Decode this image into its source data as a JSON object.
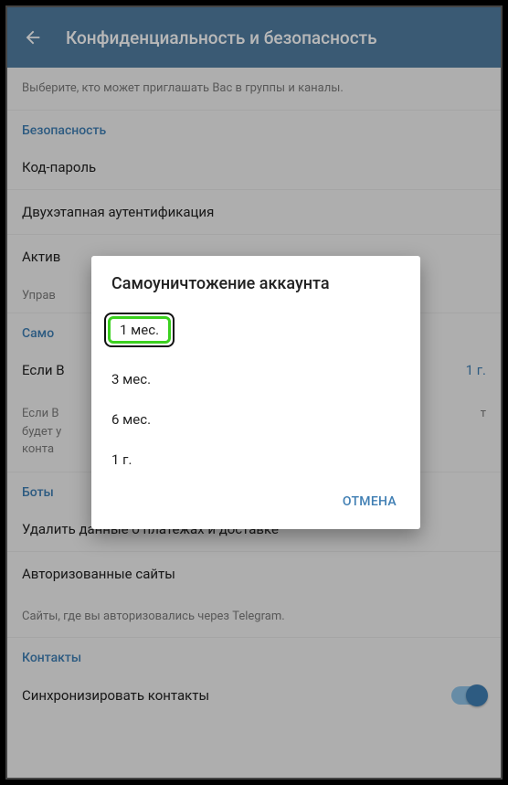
{
  "header": {
    "title": "Конфиденциальность и безопасность"
  },
  "groups_hint": "Выберите, кто может приглашать Вас в группы и каналы.",
  "security": {
    "header": "Безопасность",
    "passcode": "Код-пароль",
    "two_step": "Двухэтапная аутентификация",
    "active_prefix": "Актив",
    "manage_prefix": "Управ"
  },
  "self_destruct": {
    "header_prefix": "Само",
    "if_prefix": "Если В",
    "value": "1 г.",
    "hint_line1_prefix": "Если В",
    "hint_line1_suffix": "т",
    "hint_line2_prefix": "будет у",
    "hint_line3_prefix": "конта"
  },
  "bots": {
    "header_prefix": "Боты ",
    "payments": "Удалить данные о платежах и доставке",
    "authorized": "Авторизованные сайты",
    "hint": "Сайты, где вы авторизовались через Telegram."
  },
  "contacts": {
    "header": "Контакты",
    "sync": "Синхронизировать контакты"
  },
  "dialog": {
    "title": "Самоуничтожение аккаунта",
    "options": [
      "1 мес.",
      "3 мес.",
      "6 мес.",
      "1 г."
    ],
    "cancel": "ОТМЕНА"
  }
}
